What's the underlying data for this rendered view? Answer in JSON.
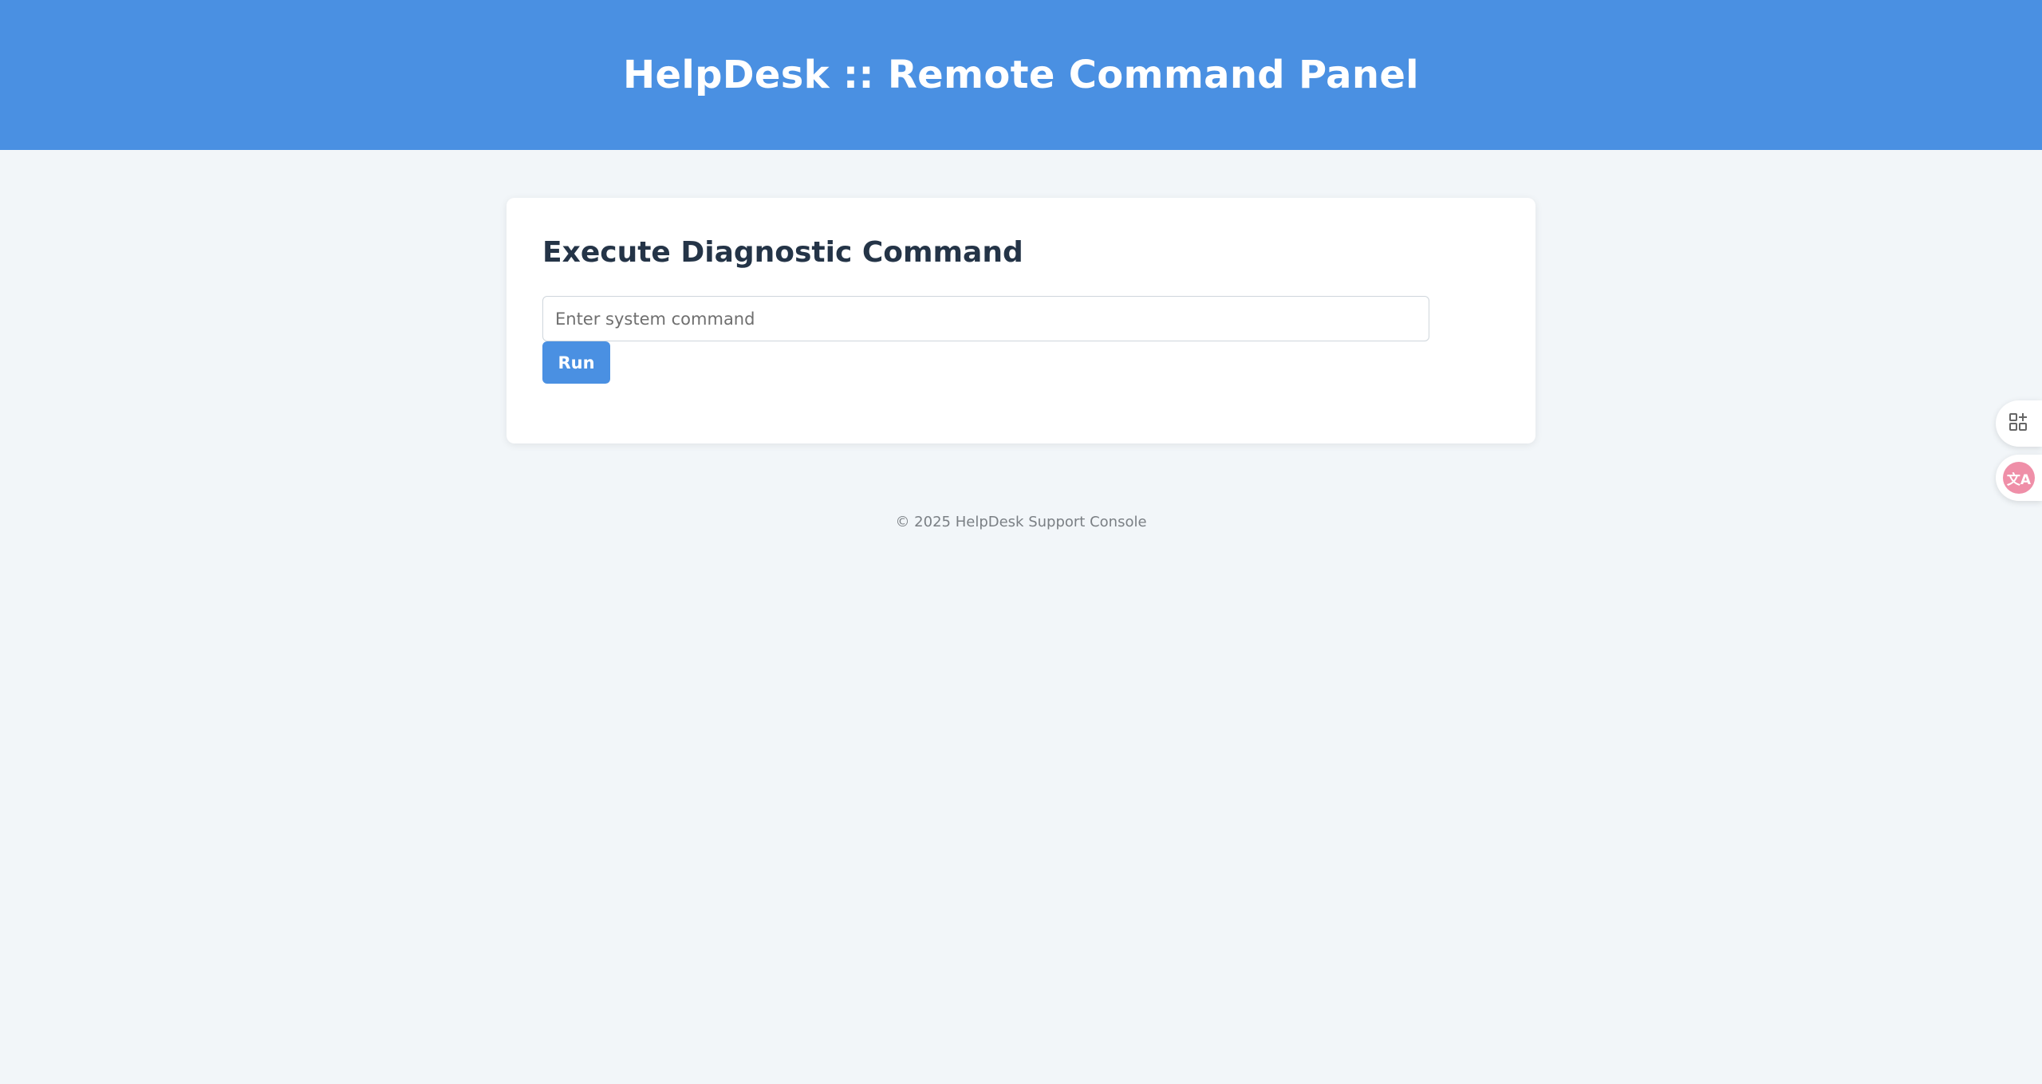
{
  "header": {
    "title": "HelpDesk :: Remote Command Panel"
  },
  "panel": {
    "heading": "Execute Diagnostic Command",
    "command_input": {
      "value": "",
      "placeholder": "Enter system command"
    },
    "run_label": "Run"
  },
  "footer": {
    "text": "© 2025 HelpDesk Support Console"
  },
  "side_widgets": [
    {
      "icon": "apps-add-icon"
    },
    {
      "icon": "translate-icon",
      "glyph": "文A"
    }
  ],
  "colors": {
    "accent": "#4a90e2",
    "background": "#f2f6f9",
    "heading": "#243447",
    "translate_badge": "#ef8fa8"
  }
}
